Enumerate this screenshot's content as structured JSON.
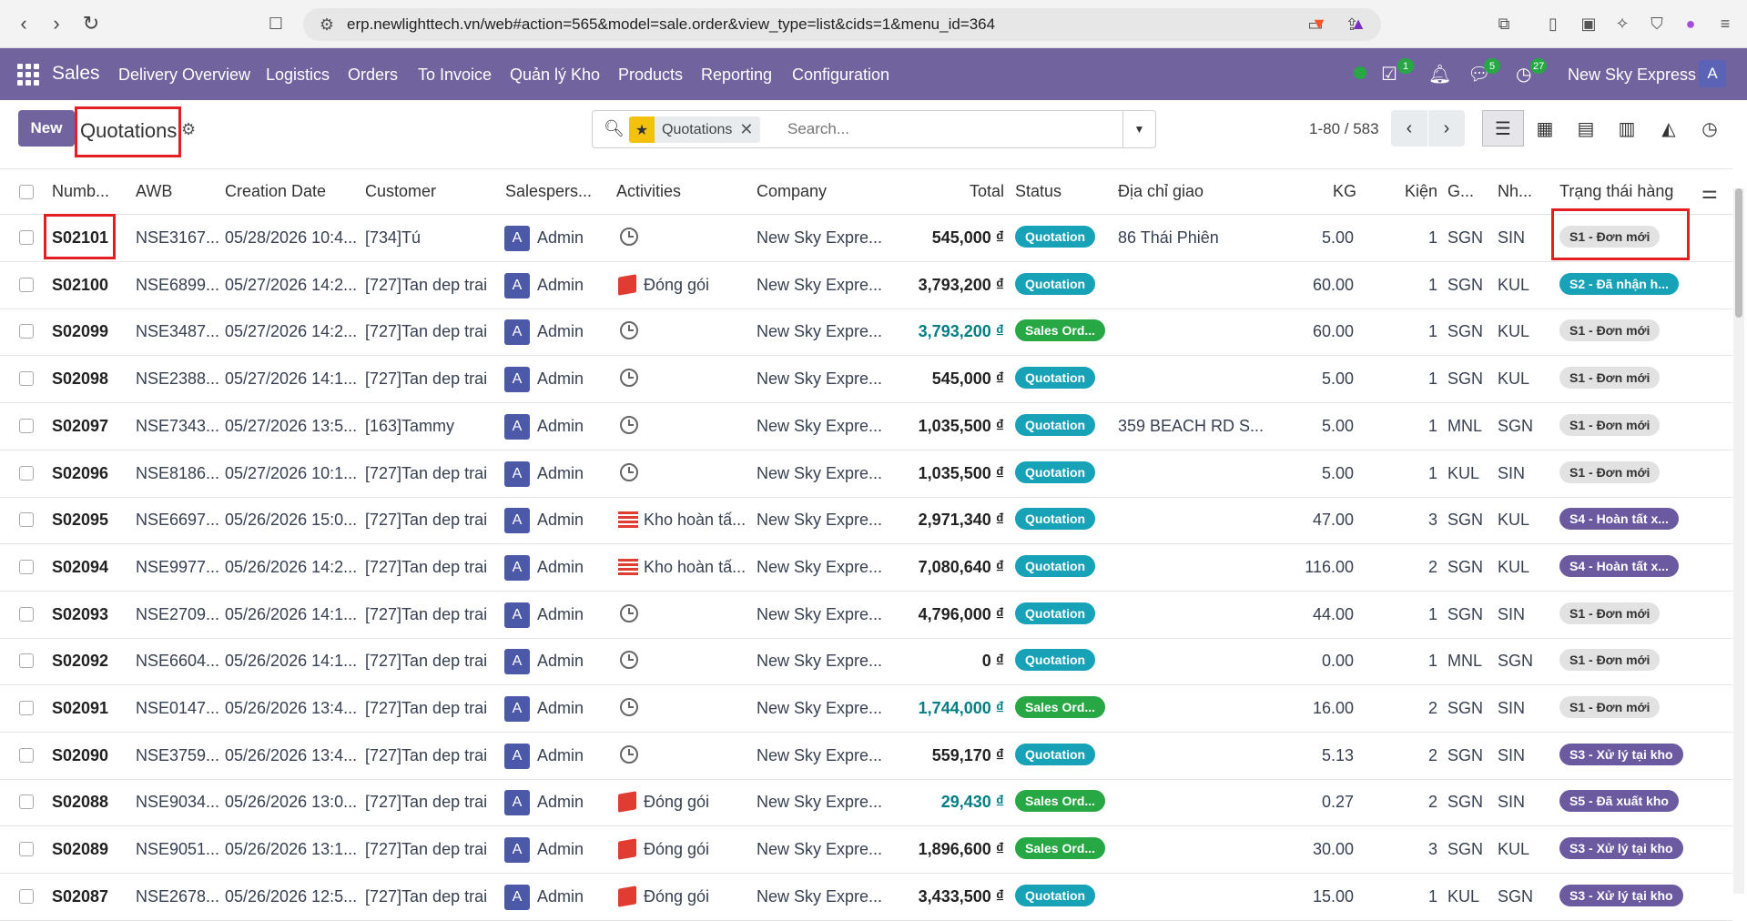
{
  "browser": {
    "url": "erp.newlighttech.vn/web#action=565&model=sale.order&view_type=list&cids=1&menu_id=364"
  },
  "navbar": {
    "brand": "Sales",
    "menu": [
      "Delivery Overview",
      "Logistics",
      "Orders",
      "To Invoice",
      "Quản lý Kho",
      "Products",
      "Reporting",
      "Configuration"
    ],
    "activity_count": "1",
    "messages_count": "5",
    "clock_count": "27",
    "company": "New Sky Express",
    "user_initial": "A"
  },
  "control_panel": {
    "new_label": "New",
    "title": "Quotations",
    "facet": "Quotations",
    "search_placeholder": "Search...",
    "pager": "1-80 / 583"
  },
  "table": {
    "columns": [
      "Numb...",
      "AWB",
      "Creation Date",
      "Customer",
      "Salespers...",
      "Activities",
      "Company",
      "Total",
      "Status",
      "Địa chỉ giao",
      "KG",
      "Kiện",
      "G...",
      "Nh...",
      "Trạng thái hàng"
    ],
    "rows": [
      {
        "number": "S02101",
        "awb": "NSE3167...",
        "date": "05/28/2026 10:4...",
        "customer": "[734]Tú",
        "sales": "Admin",
        "activity": "clock",
        "activity_text": "",
        "company": "New Sky Expre...",
        "total": "545,000 ₫",
        "total_blue": false,
        "status": "Quotation",
        "address": "86 Thái Phiên",
        "kg": "5.00",
        "kien": "1",
        "from": "SGN",
        "to": "SIN",
        "tag": "S1 - Đơn mới",
        "tag_class": "t-s1"
      },
      {
        "number": "S02100",
        "awb": "NSE6899...",
        "date": "05/27/2026 14:2...",
        "customer": "[727]Tan dep trai",
        "sales": "Admin",
        "activity": "box",
        "activity_text": "Đóng gói",
        "company": "New Sky Expre...",
        "total": "3,793,200 ₫",
        "total_blue": false,
        "status": "Quotation",
        "address": "",
        "kg": "60.00",
        "kien": "1",
        "from": "SGN",
        "to": "KUL",
        "tag": "S2 - Đã nhận h...",
        "tag_class": "t-s2"
      },
      {
        "number": "S02099",
        "awb": "NSE3487...",
        "date": "05/27/2026 14:2...",
        "customer": "[727]Tan dep trai",
        "sales": "Admin",
        "activity": "clock",
        "activity_text": "",
        "company": "New Sky Expre...",
        "total": "3,793,200 ₫",
        "total_blue": true,
        "status": "Sales Ord...",
        "address": "",
        "kg": "60.00",
        "kien": "1",
        "from": "SGN",
        "to": "KUL",
        "tag": "S1 - Đơn mới",
        "tag_class": "t-s1"
      },
      {
        "number": "S02098",
        "awb": "NSE2388...",
        "date": "05/27/2026 14:1...",
        "customer": "[727]Tan dep trai",
        "sales": "Admin",
        "activity": "clock",
        "activity_text": "",
        "company": "New Sky Expre...",
        "total": "545,000 ₫",
        "total_blue": false,
        "status": "Quotation",
        "address": "",
        "kg": "5.00",
        "kien": "1",
        "from": "SGN",
        "to": "KUL",
        "tag": "S1 - Đơn mới",
        "tag_class": "t-s1"
      },
      {
        "number": "S02097",
        "awb": "NSE7343...",
        "date": "05/27/2026 13:5...",
        "customer": "[163]Tammy",
        "sales": "Admin",
        "activity": "clock",
        "activity_text": "",
        "company": "New Sky Expre...",
        "total": "1,035,500 ₫",
        "total_blue": false,
        "status": "Quotation",
        "address": "359 BEACH RD S...",
        "kg": "5.00",
        "kien": "1",
        "from": "MNL",
        "to": "SGN",
        "tag": "S1 - Đơn mới",
        "tag_class": "t-s1"
      },
      {
        "number": "S02096",
        "awb": "NSE8186...",
        "date": "05/27/2026 10:1...",
        "customer": "[727]Tan dep trai",
        "sales": "Admin",
        "activity": "clock",
        "activity_text": "",
        "company": "New Sky Expre...",
        "total": "1,035,500 ₫",
        "total_blue": false,
        "status": "Quotation",
        "address": "",
        "kg": "5.00",
        "kien": "1",
        "from": "KUL",
        "to": "SIN",
        "tag": "S1 - Đơn mới",
        "tag_class": "t-s1"
      },
      {
        "number": "S02095",
        "awb": "NSE6697...",
        "date": "05/26/2026 15:0...",
        "customer": "[727]Tan dep trai",
        "sales": "Admin",
        "activity": "stripes",
        "activity_text": "Kho hoàn tấ...",
        "company": "New Sky Expre...",
        "total": "2,971,340 ₫",
        "total_blue": false,
        "status": "Quotation",
        "address": "",
        "kg": "47.00",
        "kien": "3",
        "from": "SGN",
        "to": "KUL",
        "tag": "S4 - Hoàn tất x...",
        "tag_class": "t-s3"
      },
      {
        "number": "S02094",
        "awb": "NSE9977...",
        "date": "05/26/2026 14:2...",
        "customer": "[727]Tan dep trai",
        "sales": "Admin",
        "activity": "stripes",
        "activity_text": "Kho hoàn tấ...",
        "company": "New Sky Expre...",
        "total": "7,080,640 ₫",
        "total_blue": false,
        "status": "Quotation",
        "address": "",
        "kg": "116.00",
        "kien": "2",
        "from": "SGN",
        "to": "KUL",
        "tag": "S4 - Hoàn tất x...",
        "tag_class": "t-s3"
      },
      {
        "number": "S02093",
        "awb": "NSE2709...",
        "date": "05/26/2026 14:1...",
        "customer": "[727]Tan dep trai",
        "sales": "Admin",
        "activity": "clock",
        "activity_text": "",
        "company": "New Sky Expre...",
        "total": "4,796,000 ₫",
        "total_blue": false,
        "status": "Quotation",
        "address": "",
        "kg": "44.00",
        "kien": "1",
        "from": "SGN",
        "to": "SIN",
        "tag": "S1 - Đơn mới",
        "tag_class": "t-s1"
      },
      {
        "number": "S02092",
        "awb": "NSE6604...",
        "date": "05/26/2026 14:1...",
        "customer": "[727]Tan dep trai",
        "sales": "Admin",
        "activity": "clock",
        "activity_text": "",
        "company": "New Sky Expre...",
        "total": "0 ₫",
        "total_blue": false,
        "status": "Quotation",
        "address": "",
        "kg": "0.00",
        "kien": "1",
        "from": "MNL",
        "to": "SGN",
        "tag": "S1 - Đơn mới",
        "tag_class": "t-s1"
      },
      {
        "number": "S02091",
        "awb": "NSE0147...",
        "date": "05/26/2026 13:4...",
        "customer": "[727]Tan dep trai",
        "sales": "Admin",
        "activity": "clock",
        "activity_text": "",
        "company": "New Sky Expre...",
        "total": "1,744,000 ₫",
        "total_blue": true,
        "status": "Sales Ord...",
        "address": "",
        "kg": "16.00",
        "kien": "2",
        "from": "SGN",
        "to": "SIN",
        "tag": "S1 - Đơn mới",
        "tag_class": "t-s1"
      },
      {
        "number": "S02090",
        "awb": "NSE3759...",
        "date": "05/26/2026 13:4...",
        "customer": "[727]Tan dep trai",
        "sales": "Admin",
        "activity": "clock",
        "activity_text": "",
        "company": "New Sky Expre...",
        "total": "559,170 ₫",
        "total_blue": false,
        "status": "Quotation",
        "address": "",
        "kg": "5.13",
        "kien": "2",
        "from": "SGN",
        "to": "SIN",
        "tag": "S3 - Xử lý tại kho",
        "tag_class": "t-s3"
      },
      {
        "number": "S02088",
        "awb": "NSE9034...",
        "date": "05/26/2026 13:0...",
        "customer": "[727]Tan dep trai",
        "sales": "Admin",
        "activity": "box",
        "activity_text": "Đóng gói",
        "company": "New Sky Expre...",
        "total": "29,430 ₫",
        "total_blue": true,
        "status": "Sales Ord...",
        "address": "",
        "kg": "0.27",
        "kien": "2",
        "from": "SGN",
        "to": "SIN",
        "tag": "S5 - Đã xuất kho",
        "tag_class": "t-s3"
      },
      {
        "number": "S02089",
        "awb": "NSE9051...",
        "date": "05/26/2026 13:1...",
        "customer": "[727]Tan dep trai",
        "sales": "Admin",
        "activity": "box",
        "activity_text": "Đóng gói",
        "company": "New Sky Expre...",
        "total": "1,896,600 ₫",
        "total_blue": false,
        "status": "Sales Ord...",
        "address": "",
        "kg": "30.00",
        "kien": "3",
        "from": "SGN",
        "to": "KUL",
        "tag": "S3 - Xử lý tại kho",
        "tag_class": "t-s3"
      },
      {
        "number": "S02087",
        "awb": "NSE2678...",
        "date": "05/26/2026 12:5...",
        "customer": "[727]Tan dep trai",
        "sales": "Admin",
        "activity": "box",
        "activity_text": "Đóng gói",
        "company": "New Sky Expre...",
        "total": "3,433,500 ₫",
        "total_blue": false,
        "status": "Quotation",
        "address": "",
        "kg": "15.00",
        "kien": "1",
        "from": "KUL",
        "to": "SGN",
        "tag": "S3 - Xử lý tại kho",
        "tag_class": "t-s3"
      }
    ]
  },
  "colors": {
    "navbar": "#71639e",
    "quotation_badge": "#17a2b8",
    "sales_order_badge": "#28a745",
    "highlight": "#e51e25"
  }
}
